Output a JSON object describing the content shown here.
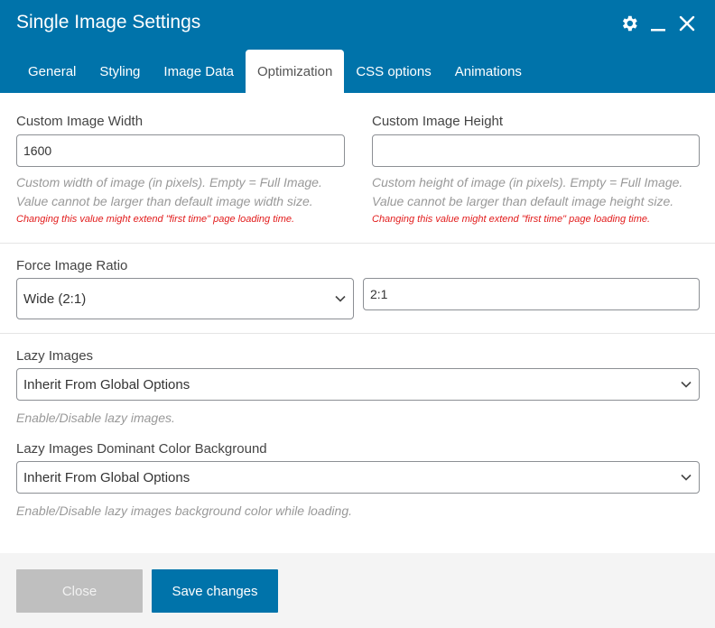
{
  "header": {
    "title": "Single Image Settings",
    "icons": [
      "gear-icon",
      "minimize-icon",
      "close-icon"
    ]
  },
  "tabs": [
    {
      "label": "General",
      "active": false
    },
    {
      "label": "Styling",
      "active": false
    },
    {
      "label": "Image Data",
      "active": false
    },
    {
      "label": "Optimization",
      "active": true
    },
    {
      "label": "CSS options",
      "active": false
    },
    {
      "label": "Animations",
      "active": false
    }
  ],
  "custom_width": {
    "label": "Custom Image Width",
    "value": "1600",
    "help_line1": "Custom width of image (in pixels). Empty = Full Image.",
    "help_line2": "Value cannot be larger than default image width size.",
    "warning": "Changing this value might extend \"first time\" page loading time."
  },
  "custom_height": {
    "label": "Custom Image Height",
    "value": "",
    "help_line1": "Custom height of image (in pixels). Empty = Full Image.",
    "help_line2": "Value cannot be larger than default image height size.",
    "warning": "Changing this value might extend \"first time\" page loading time."
  },
  "force_ratio": {
    "label": "Force Image Ratio",
    "selected": "Wide (2:1)",
    "custom_value": "2:1"
  },
  "lazy_images": {
    "label": "Lazy Images",
    "selected": "Inherit From Global Options",
    "help": "Enable/Disable lazy images."
  },
  "lazy_dominant": {
    "label": "Lazy Images Dominant Color Background",
    "selected": "Inherit From Global Options",
    "help": "Enable/Disable lazy images background color while loading."
  },
  "footer": {
    "close_label": "Close",
    "save_label": "Save changes"
  },
  "colors": {
    "accent": "#0073aa",
    "warning": "#e21b1b",
    "disabled_button": "#bfbfbf"
  }
}
